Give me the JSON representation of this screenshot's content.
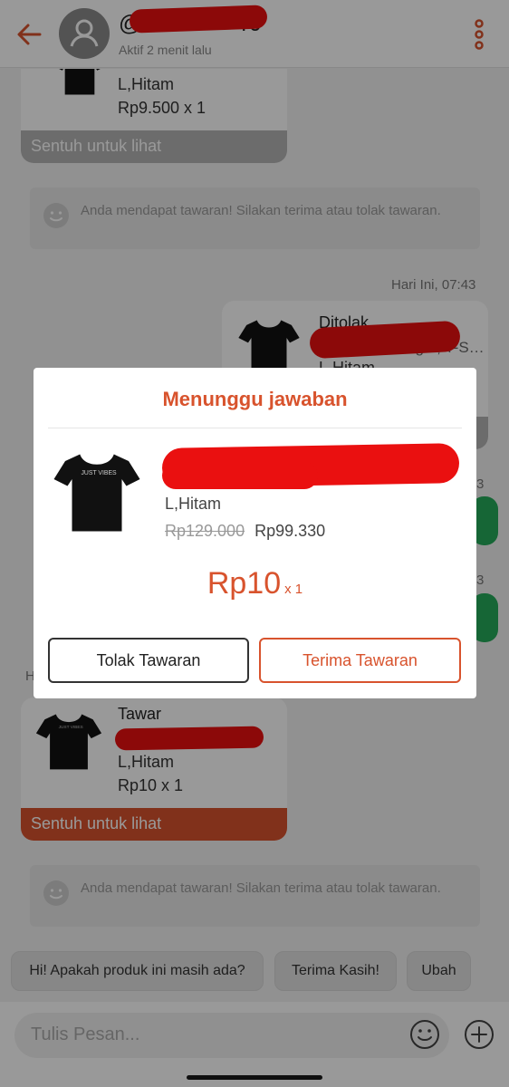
{
  "header": {
    "username_prefix": "@",
    "username_suffix": "r0",
    "status": "Aktif 2 menit lalu"
  },
  "chat": {
    "card1": {
      "variant": "L,Hitam",
      "price_qty": "Rp9.500 x 1",
      "touch_label": "Sentuh untuk lihat"
    },
    "notice1": "Anda mendapat tawaran! Silakan terima atau tolak tawaran.",
    "time1": "Hari Ini, 07:43",
    "card2": {
      "label": "Ditolak",
      "name_tail": "…ager, T-S…",
      "variant": "L,Hitam"
    },
    "side_time_a": "3",
    "side_time_b": "3",
    "side_h": "H",
    "card3": {
      "label": "Tawar",
      "variant": "L,Hitam",
      "price_qty": "Rp10 x 1",
      "touch_label": "Sentuh untuk lihat"
    },
    "notice2": "Anda mendapat tawaran! Silakan terima atau tolak tawaran."
  },
  "quick_replies": [
    "Hi! Apakah produk ini masih ada?",
    "Terima Kasih!",
    "Ubah"
  ],
  "input": {
    "placeholder": "Tulis Pesan..."
  },
  "modal": {
    "title": "Menunggu jawaban",
    "variant": "L,Hitam",
    "original_price": "Rp129.000",
    "current_price": "Rp99.330",
    "offer_price": "Rp10",
    "offer_qty": "x 1",
    "reject_label": "Tolak Tawaran",
    "accept_label": "Terima Tawaran"
  },
  "colors": {
    "accent": "#d8532d",
    "redaction": "#ea1010",
    "touch_bar_active": "#d8532d",
    "touch_bar_muted": "#b5b5b5",
    "chat_green": "#26aa5a"
  }
}
